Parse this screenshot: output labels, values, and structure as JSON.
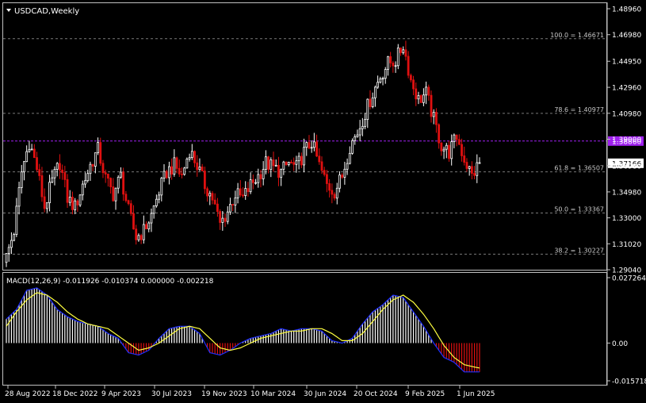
{
  "window": {
    "title": "USDCAD,Weekly",
    "menu_arrow": "triangle-down-icon"
  },
  "colors": {
    "background": "#000000",
    "frame": "#c0c0c0",
    "text": "#ffffff",
    "bull": "#ffffff",
    "bear": "#e01010",
    "fib": "#7a7a7a",
    "level_line": "#a020f0",
    "macd_main": "#2030ff",
    "macd_signal": "#ffff40",
    "hist_pos": "#ffffff",
    "hist_neg": "#e01010"
  },
  "chart_data": [
    {
      "type": "candlestick",
      "title": "USDCAD,Weekly",
      "ylim": [
        1.2904,
        1.4896
      ],
      "y_ticks": [
        "1.48960",
        "1.46980",
        "1.44950",
        "1.42960",
        "1.40980",
        "1.39000",
        "1.36980",
        "1.34980",
        "1.33000",
        "1.31020",
        "1.29040"
      ],
      "x_ticks": [
        "28 Aug 2022",
        "18 Dec 2022",
        "9 Apr 2023",
        "30 Jul 2023",
        "19 Nov 2023",
        "10 Mar 2024",
        "30 Jun 2024",
        "20 Oct 2024",
        "9 Feb 2025",
        "1 Jun 2025"
      ],
      "fib_levels": [
        {
          "label": "100.0 = 1.46671",
          "value": 1.46671
        },
        {
          "label": "78.6 = 1.40977",
          "value": 1.40977
        },
        {
          "label": "61.8 = 1.36507",
          "value": 1.36507
        },
        {
          "label": "50.0 = 1.33367",
          "value": 1.33367
        },
        {
          "label": "38.2 = 1.30227",
          "value": 1.30227
        }
      ],
      "horizontal_level": {
        "label": "1.38860",
        "value": 1.3886
      },
      "current_price": {
        "label": "1.37166",
        "value": 1.37166
      },
      "close_path": [
        [
          0,
          1.3
        ],
        [
          3,
          1.32
        ],
        [
          6,
          1.365
        ],
        [
          9,
          1.388
        ],
        [
          12,
          1.368
        ],
        [
          15,
          1.338
        ],
        [
          18,
          1.358
        ],
        [
          21,
          1.372
        ],
        [
          24,
          1.345
        ],
        [
          27,
          1.338
        ],
        [
          30,
          1.355
        ],
        [
          33,
          1.37
        ],
        [
          36,
          1.382
        ],
        [
          39,
          1.36
        ],
        [
          42,
          1.348
        ],
        [
          45,
          1.362
        ],
        [
          48,
          1.335
        ],
        [
          51,
          1.315
        ],
        [
          54,
          1.32
        ],
        [
          57,
          1.332
        ],
        [
          60,
          1.35
        ],
        [
          63,
          1.365
        ],
        [
          66,
          1.37
        ],
        [
          69,
          1.362
        ],
        [
          72,
          1.382
        ],
        [
          75,
          1.37
        ],
        [
          78,
          1.355
        ],
        [
          81,
          1.345
        ],
        [
          84,
          1.325
        ],
        [
          87,
          1.335
        ],
        [
          90,
          1.348
        ],
        [
          93,
          1.345
        ],
        [
          96,
          1.355
        ],
        [
          99,
          1.362
        ],
        [
          102,
          1.372
        ],
        [
          105,
          1.368
        ],
        [
          108,
          1.365
        ],
        [
          111,
          1.372
        ],
        [
          114,
          1.368
        ],
        [
          117,
          1.38
        ],
        [
          120,
          1.388
        ],
        [
          123,
          1.37
        ],
        [
          126,
          1.355
        ],
        [
          129,
          1.35
        ],
        [
          132,
          1.362
        ],
        [
          135,
          1.385
        ],
        [
          138,
          1.395
        ],
        [
          141,
          1.41
        ],
        [
          144,
          1.425
        ],
        [
          147,
          1.438
        ],
        [
          150,
          1.448
        ],
        [
          153,
          1.45
        ],
        [
          156,
          1.462
        ],
        [
          159,
          1.435
        ],
        [
          162,
          1.42
        ],
        [
          165,
          1.425
        ],
        [
          168,
          1.405
        ],
        [
          171,
          1.385
        ],
        [
          174,
          1.38
        ],
        [
          177,
          1.392
        ],
        [
          180,
          1.375
        ],
        [
          183,
          1.362
        ],
        [
          186,
          1.372
        ]
      ],
      "macd": {
        "label": "MACD(12,26,9) -0.011926 -0.010374 0.000000 -0.002218",
        "ylim": [
          -0.015718,
          0.027264
        ],
        "y_ticks": [
          "0.027264",
          "0.00",
          "-0.015718"
        ],
        "main_path": [
          [
            0,
            0.01
          ],
          [
            4,
            0.014
          ],
          [
            8,
            0.022
          ],
          [
            12,
            0.023
          ],
          [
            16,
            0.02
          ],
          [
            20,
            0.014
          ],
          [
            24,
            0.011
          ],
          [
            28,
            0.009
          ],
          [
            32,
            0.008
          ],
          [
            36,
            0.007
          ],
          [
            40,
            0.004
          ],
          [
            44,
            0.002
          ],
          [
            48,
            -0.004
          ],
          [
            52,
            -0.005
          ],
          [
            56,
            -0.003
          ],
          [
            60,
            0.002
          ],
          [
            64,
            0.006
          ],
          [
            68,
            0.007
          ],
          [
            72,
            0.007
          ],
          [
            76,
            0.004
          ],
          [
            80,
            -0.004
          ],
          [
            84,
            -0.005
          ],
          [
            88,
            -0.003
          ],
          [
            92,
            0.0
          ],
          [
            96,
            0.002
          ],
          [
            100,
            0.003
          ],
          [
            104,
            0.004
          ],
          [
            108,
            0.006
          ],
          [
            112,
            0.005
          ],
          [
            116,
            0.006
          ],
          [
            120,
            0.006
          ],
          [
            124,
            0.005
          ],
          [
            128,
            0.001
          ],
          [
            132,
            0.0
          ],
          [
            136,
            0.002
          ],
          [
            140,
            0.008
          ],
          [
            144,
            0.013
          ],
          [
            148,
            0.016
          ],
          [
            152,
            0.02
          ],
          [
            156,
            0.019
          ],
          [
            160,
            0.013
          ],
          [
            164,
            0.007
          ],
          [
            168,
            0.0
          ],
          [
            172,
            -0.006
          ],
          [
            176,
            -0.008
          ],
          [
            180,
            -0.012
          ],
          [
            184,
            -0.012
          ],
          [
            186,
            -0.012
          ]
        ],
        "signal_path": [
          [
            0,
            0.007
          ],
          [
            4,
            0.013
          ],
          [
            8,
            0.018
          ],
          [
            12,
            0.021
          ],
          [
            16,
            0.02
          ],
          [
            20,
            0.017
          ],
          [
            24,
            0.013
          ],
          [
            28,
            0.01
          ],
          [
            32,
            0.008
          ],
          [
            36,
            0.007
          ],
          [
            40,
            0.006
          ],
          [
            44,
            0.003
          ],
          [
            48,
            0.0
          ],
          [
            52,
            -0.003
          ],
          [
            56,
            -0.002
          ],
          [
            60,
            0.0
          ],
          [
            64,
            0.003
          ],
          [
            68,
            0.006
          ],
          [
            72,
            0.007
          ],
          [
            76,
            0.006
          ],
          [
            80,
            0.002
          ],
          [
            84,
            -0.002
          ],
          [
            88,
            -0.003
          ],
          [
            92,
            -0.002
          ],
          [
            96,
            0.0
          ],
          [
            100,
            0.002
          ],
          [
            104,
            0.003
          ],
          [
            108,
            0.004
          ],
          [
            112,
            0.005
          ],
          [
            116,
            0.005
          ],
          [
            120,
            0.006
          ],
          [
            124,
            0.006
          ],
          [
            128,
            0.004
          ],
          [
            132,
            0.001
          ],
          [
            136,
            0.001
          ],
          [
            140,
            0.004
          ],
          [
            144,
            0.009
          ],
          [
            148,
            0.014
          ],
          [
            152,
            0.018
          ],
          [
            156,
            0.02
          ],
          [
            160,
            0.017
          ],
          [
            164,
            0.012
          ],
          [
            168,
            0.006
          ],
          [
            172,
            -0.001
          ],
          [
            176,
            -0.006
          ],
          [
            180,
            -0.009
          ],
          [
            184,
            -0.01
          ],
          [
            186,
            -0.0104
          ]
        ]
      }
    }
  ]
}
